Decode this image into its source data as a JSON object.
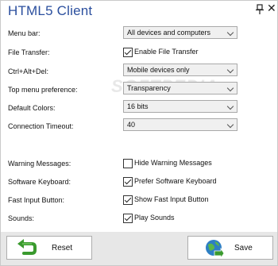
{
  "window": {
    "title": "HTML5 Client"
  },
  "watermark": "SOFTPEDIA",
  "settings": {
    "menu_bar": {
      "label": "Menu bar:",
      "value": "All devices and computers"
    },
    "file_transfer": {
      "label": "File Transfer:",
      "option": "Enable File Transfer",
      "checked": true
    },
    "ctrl_alt_del": {
      "label": "Ctrl+Alt+Del:",
      "value": "Mobile devices only"
    },
    "top_menu": {
      "label": "Top menu preference:",
      "value": "Transparency"
    },
    "default_colors": {
      "label": "Default Colors:",
      "value": "16 bits"
    },
    "connection_timeout": {
      "label": "Connection Timeout:",
      "value": "40"
    },
    "warning_messages": {
      "label": "Warning Messages:",
      "option": "Hide Warning Messages",
      "checked": false
    },
    "software_keyboard": {
      "label": "Software Keyboard:",
      "option": "Prefer Software Keyboard",
      "checked": true
    },
    "fast_input": {
      "label": "Fast Input Button:",
      "option": "Show Fast Input Button",
      "checked": true
    },
    "sounds": {
      "label": "Sounds:",
      "option": "Play Sounds",
      "checked": true
    }
  },
  "buttons": {
    "reset": "Reset",
    "save": "Save"
  },
  "colors": {
    "title": "#2b4f9e",
    "reset_icon": "#3a9a2e",
    "save_icon": "#2e7fc4"
  },
  "icons": {
    "pin": "pin-icon",
    "close": "close-icon",
    "reset": "undo-arrow-icon",
    "save": "globe-arrow-icon"
  }
}
